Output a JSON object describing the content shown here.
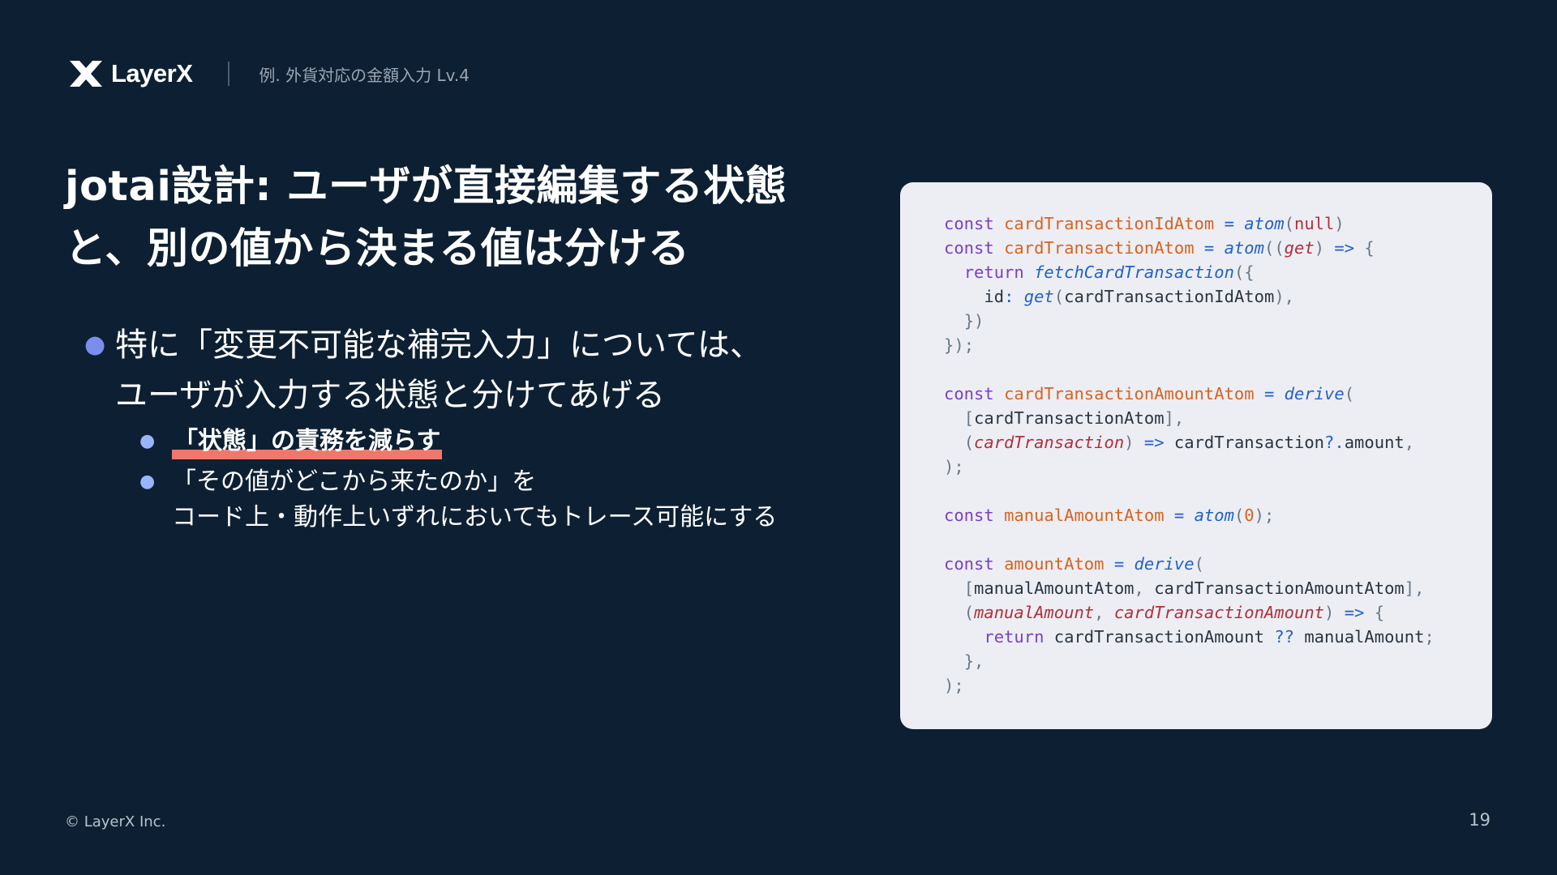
{
  "header": {
    "logo_text": "LayerX",
    "breadcrumb": "例. 外貨対応の金額入力 Lv.4"
  },
  "title": {
    "line1": "jotai設計: ユーザが直接編集する状態",
    "line2": "と、別の値から決まる値は分ける"
  },
  "bullets": {
    "main": {
      "line1": "特に「変更不可能な補完入力」については、",
      "line2": "ユーザが入力する状態と分けてあげる"
    },
    "sub1": "「状態」の責務を減らす",
    "sub2": {
      "line1": "「その値がどこから来たのか」を",
      "line2": "コード上・動作上いずれにおいてもトレース可能にする"
    }
  },
  "code": {
    "lines": [
      "const cardTransactionIdAtom = atom(null)",
      "const cardTransactionAtom = atom((get) => {",
      "  return fetchCardTransaction({",
      "    id: get(cardTransactionIdAtom),",
      "  })",
      "});",
      "",
      "const cardTransactionAmountAtom = derive(",
      "  [cardTransactionAtom],",
      "  (cardTransaction) => cardTransaction?.amount,",
      ");",
      "",
      "const manualAmountAtom = atom(0);",
      "",
      "const amountAtom = derive(",
      "  [manualAmountAtom, cardTransactionAmountAtom],",
      "  (manualAmount, cardTransactionAmount) => {",
      "    return cardTransactionAmount ?? manualAmount;",
      "  },",
      ");"
    ]
  },
  "footer": {
    "copyright": "© LayerX Inc.",
    "page_number": "19"
  },
  "colors": {
    "background": "#0d2033",
    "code_background": "#eceef4",
    "highlight": "#f0776c",
    "bullet": "#7c8df0"
  }
}
